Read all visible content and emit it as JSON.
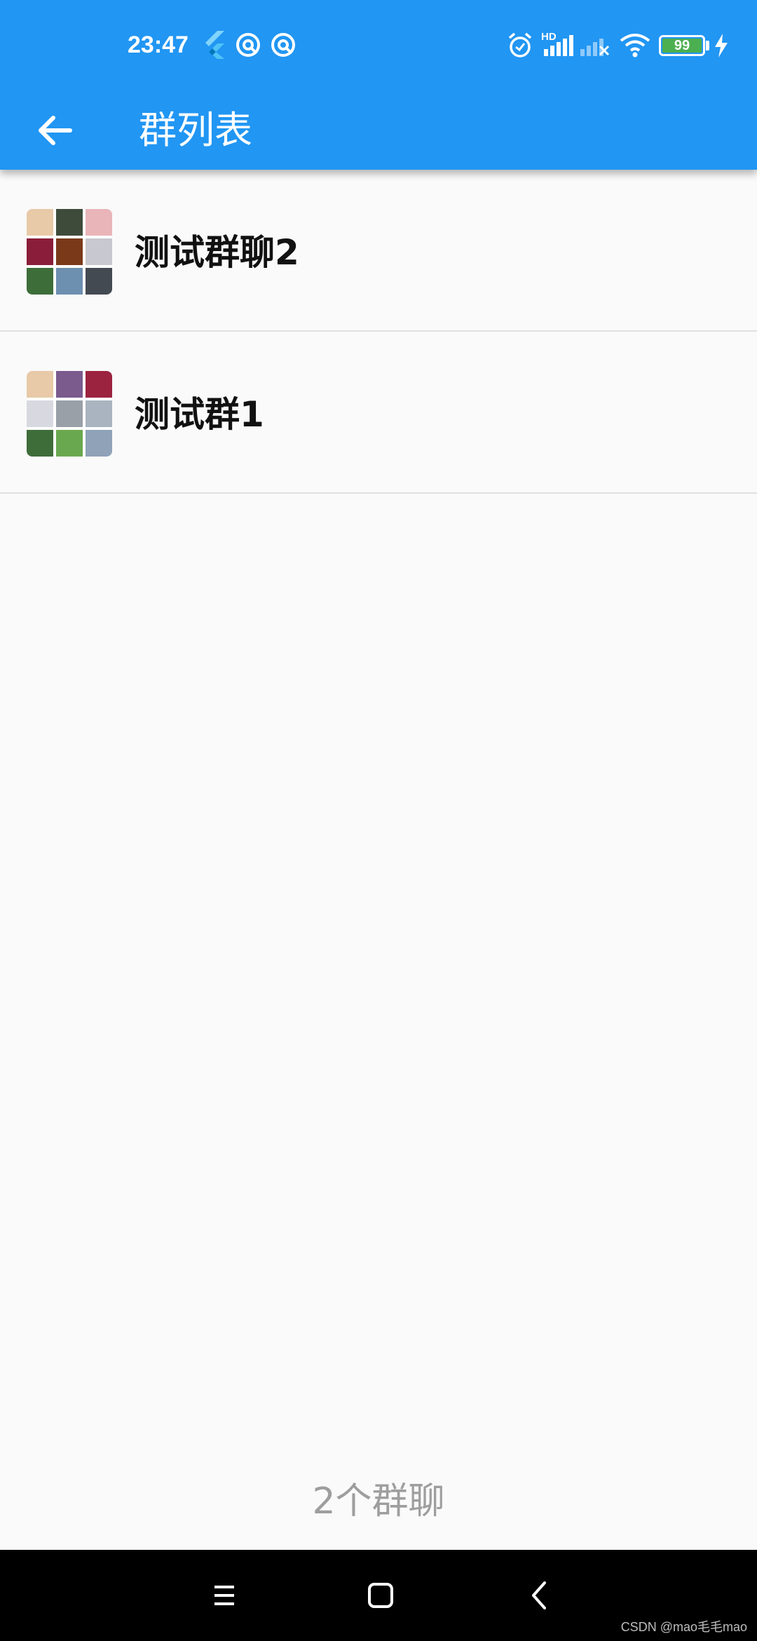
{
  "status_bar": {
    "time": "23:47",
    "battery_level": "99",
    "network_label": "HD",
    "icons": [
      "flutter-icon",
      "debug-icon",
      "debug-icon",
      "alarm-icon",
      "signal-icon",
      "signal-off-icon",
      "wifi-icon",
      "battery-icon",
      "charging-icon"
    ]
  },
  "app_bar": {
    "title": "群列表",
    "back_icon": "arrow-back-icon",
    "color": "#2196f3"
  },
  "groups": [
    {
      "name": "测试群聊2",
      "avatar_tiles": [
        "#e8c9a8",
        "#3f4b3a",
        "#e9b5b8",
        "#8a1d3a",
        "#7a3a1a",
        "#c8c8d0",
        "#3d6e3a",
        "#6d8fb0",
        "#444a52"
      ]
    },
    {
      "name": "测试群1",
      "avatar_tiles": [
        "#e8c9a8",
        "#7b5a8e",
        "#9c2340",
        "#d8d8e0",
        "#9aa0a8",
        "#a9b4c0",
        "#3e6d3a",
        "#6aa84f",
        "#8fa2b8"
      ]
    }
  ],
  "footer": {
    "count_text": "2个群聊"
  },
  "nav_bar": {
    "icons": [
      "menu-icon",
      "home-icon",
      "back-icon"
    ]
  },
  "watermark": "CSDN @mao毛毛mao"
}
